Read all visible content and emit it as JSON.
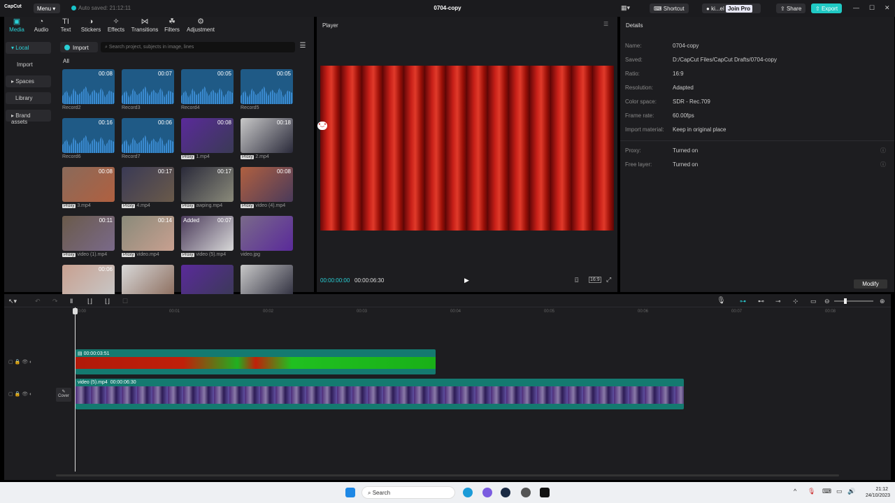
{
  "app": {
    "logo": "CapCut",
    "menu": "Menu",
    "autosave": "Auto saved: 21:12:11",
    "title": "0704-copy"
  },
  "topright": {
    "shortcut": "Shortcut",
    "user": "ki...el",
    "join": "Join Pro",
    "share": "Share",
    "export": "Export"
  },
  "tools": [
    "Media",
    "Audio",
    "Text",
    "Stickers",
    "Effects",
    "Transitions",
    "Filters",
    "Adjustment"
  ],
  "sidebar": [
    "Local",
    "Import",
    "Spaces",
    "Library",
    "Brand assets"
  ],
  "media": {
    "import": "Import",
    "search_placeholder": "Search project, subjects in image, lines",
    "filter": "All",
    "items": [
      {
        "name": "Record2",
        "dur": "00:08",
        "audio": true
      },
      {
        "name": "Record3",
        "dur": "00:07",
        "audio": true
      },
      {
        "name": "Record4",
        "dur": "00:05",
        "audio": true
      },
      {
        "name": "Record5",
        "dur": "00:05",
        "audio": true
      },
      {
        "name": "Record6",
        "dur": "00:16",
        "audio": true
      },
      {
        "name": "Record7",
        "dur": "00:06",
        "audio": true
      },
      {
        "name": "1.mp4",
        "dur": "00:08",
        "proxy": true
      },
      {
        "name": "2.mp4",
        "dur": "00:18",
        "proxy": true
      },
      {
        "name": "3.mp4",
        "dur": "00:08",
        "proxy": true
      },
      {
        "name": "4.mp4",
        "dur": "00:17",
        "proxy": true
      },
      {
        "name": "awping.mp4",
        "dur": "00:17",
        "proxy": true
      },
      {
        "name": "video (4).mp4",
        "dur": "00:08",
        "proxy": true
      },
      {
        "name": "video (1).mp4",
        "dur": "00:11",
        "proxy": true
      },
      {
        "name": "video.mp4",
        "dur": "00:14",
        "proxy": true
      },
      {
        "name": "video (5).mp4",
        "dur": "00:07",
        "proxy": true,
        "added": "Added"
      },
      {
        "name": "video.jpg",
        "dur": ""
      },
      {
        "name": "",
        "dur": "00:06"
      },
      {
        "name": "",
        "dur": ""
      },
      {
        "name": "",
        "dur": ""
      },
      {
        "name": "",
        "dur": ""
      }
    ]
  },
  "player": {
    "title": "Player",
    "current": "00:00:00:00",
    "total": "00:00:06:30",
    "ratio": "16:9"
  },
  "details": {
    "title": "Details",
    "rows": [
      {
        "label": "Name:",
        "value": "0704-copy"
      },
      {
        "label": "Saved:",
        "value": "D:/CapCut Files/CapCut Drafts/0704-copy"
      },
      {
        "label": "Ratio:",
        "value": "16:9"
      },
      {
        "label": "Resolution:",
        "value": "Adapted"
      },
      {
        "label": "Color space:",
        "value": "SDR - Rec.709"
      },
      {
        "label": "Frame rate:",
        "value": "60.00fps"
      },
      {
        "label": "Import material:",
        "value": "Keep in original place"
      },
      {
        "label": "Proxy:",
        "value": "Turned on"
      },
      {
        "label": "Free layer:",
        "value": "Turned on"
      }
    ],
    "modify": "Modify"
  },
  "timeline": {
    "ticks": [
      "00:00",
      "00:01",
      "00:02",
      "00:03",
      "00:04",
      "00:05",
      "00:06",
      "00:07",
      "00:08"
    ],
    "clip1": {
      "label": "00:00:03:51"
    },
    "clip2": {
      "label": "video (5).mp4",
      "dur": "00:00:06:30"
    },
    "cover": "Cover"
  },
  "taskbar": {
    "search": "Search",
    "time": "21:12",
    "date": "24/10/2023"
  }
}
